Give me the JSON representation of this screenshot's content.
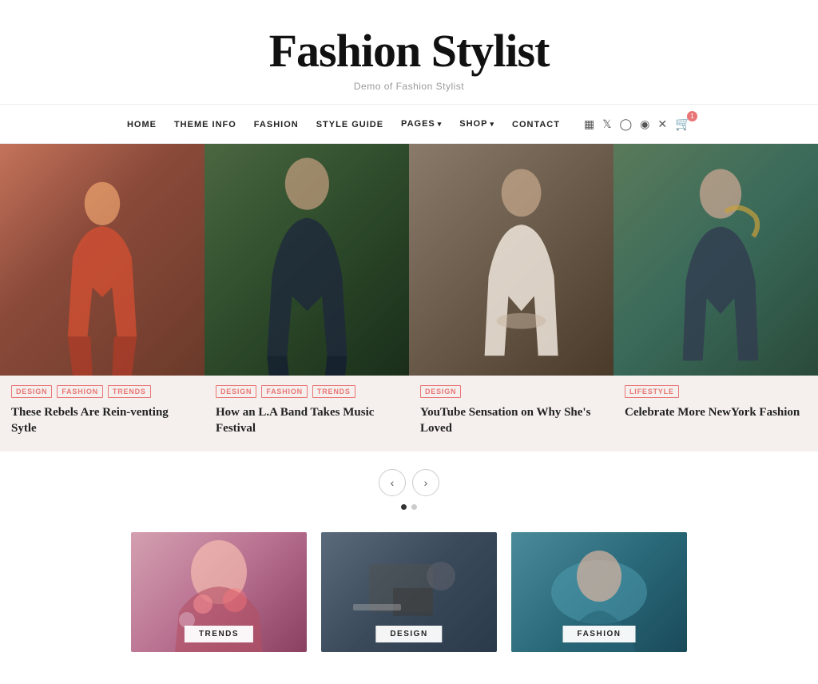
{
  "site": {
    "title": "Fashion Stylist",
    "subtitle": "Demo of Fashion Stylist"
  },
  "nav": {
    "links": [
      {
        "label": "HOME",
        "hasDropdown": false
      },
      {
        "label": "THEME INFO",
        "hasDropdown": false
      },
      {
        "label": "FASHION",
        "hasDropdown": false
      },
      {
        "label": "STYLE GUIDE",
        "hasDropdown": false
      },
      {
        "label": "PAGES",
        "hasDropdown": true
      },
      {
        "label": "SHOP",
        "hasDropdown": true
      },
      {
        "label": "CONTACT",
        "hasDropdown": false
      }
    ],
    "social": [
      "facebook",
      "twitter",
      "instagram",
      "pinterest",
      "x"
    ],
    "cartCount": "1"
  },
  "cards": [
    {
      "tags": [
        "DESIGN",
        "FASHION",
        "TRENDS"
      ],
      "title": "These Rebels Are Rein-venting Sytle",
      "imgClass": "img-1"
    },
    {
      "tags": [
        "DESIGN",
        "FASHION",
        "TRENDS"
      ],
      "title": "How an L.A Band Takes Music Festival",
      "imgClass": "img-2"
    },
    {
      "tags": [
        "DESIGN"
      ],
      "title": "YouTube Sensation on Why She's Loved",
      "imgClass": "img-3"
    },
    {
      "tags": [
        "LIFESTYLE"
      ],
      "title": "Celebrate More NewYork Fashion",
      "imgClass": "img-4"
    }
  ],
  "pagination": {
    "prevLabel": "‹",
    "nextLabel": "›"
  },
  "bottomCards": [
    {
      "label": "TRENDS",
      "imgClass": "bc-1"
    },
    {
      "label": "DESIGN",
      "imgClass": "bc-2"
    },
    {
      "label": "FASHION",
      "imgClass": "bc-3"
    }
  ]
}
